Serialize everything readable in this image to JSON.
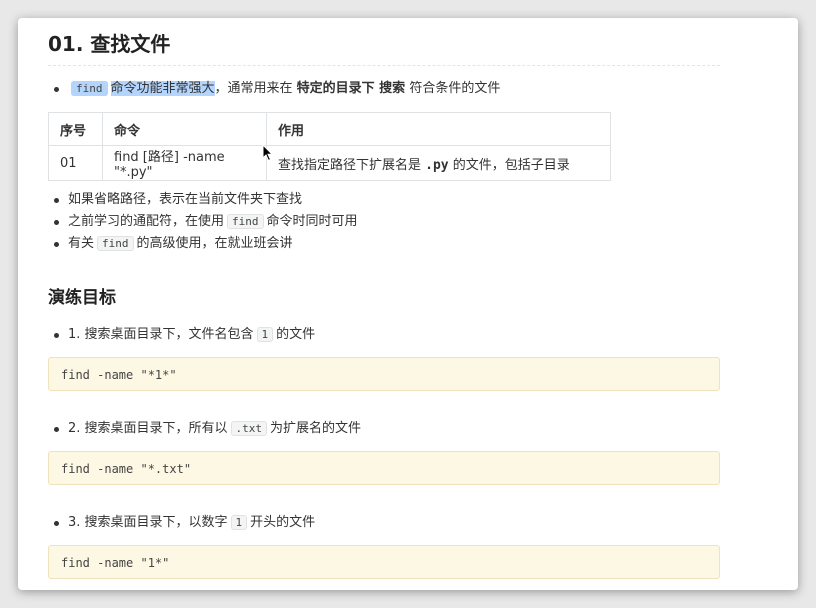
{
  "section": {
    "title": "01. 查找文件",
    "intro": {
      "code": "find",
      "highlight": "命令功能非常强大",
      "text1": "，通常用来在 ",
      "bold1": "特定的目录下 搜索",
      "text2": " 符合条件的文件"
    }
  },
  "table": {
    "headers": [
      "序号",
      "命令",
      "作用"
    ],
    "row": {
      "num": "01",
      "cmd": "find [路径] -name \"*.py\"",
      "desc_pre": "查找指定路径下扩展名是 ",
      "desc_code": ".py",
      "desc_post": " 的文件，包括子目录"
    }
  },
  "notes": {
    "n1": "如果省略路径，表示在当前文件夹下查找",
    "n2_pre": "之前学习的通配符，在使用",
    "n2_code": "find",
    "n2_post": "命令时同时可用",
    "n3_pre": "有关",
    "n3_code": "find",
    "n3_post": "的高级使用，在就业班会讲"
  },
  "practice": {
    "title": "演练目标",
    "items": [
      {
        "pre": "1. 搜索桌面目录下，文件名包含",
        "code": "1",
        "post": "的文件",
        "block": "find -name \"*1*\""
      },
      {
        "pre": "2. 搜索桌面目录下，所有以",
        "code": ".txt",
        "post": "为扩展名的文件",
        "block": "find -name \"*.txt\""
      },
      {
        "pre": "3. 搜索桌面目录下，以数字",
        "code": "1",
        "post": "开头的文件",
        "block": "find -name \"1*\""
      }
    ]
  },
  "colors": {
    "selection": "#b3d4fc",
    "code_block_bg": "#fdf8e4"
  }
}
